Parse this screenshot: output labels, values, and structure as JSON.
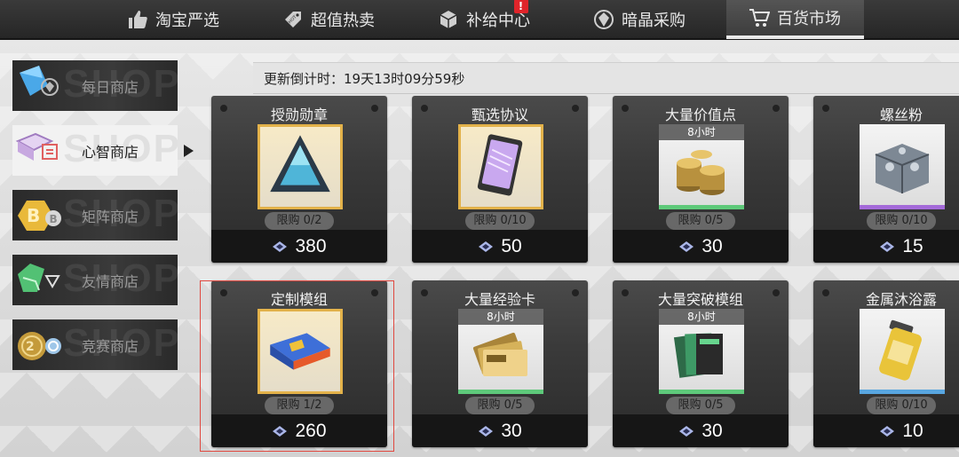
{
  "nav": {
    "tabs": [
      {
        "label": "淘宝严选",
        "icon": "thumbs-up-icon"
      },
      {
        "label": "超值热卖",
        "icon": "hot-tag-icon"
      },
      {
        "label": "补给中心",
        "icon": "supply-box-icon",
        "badge": "!"
      },
      {
        "label": "暗晶采购",
        "icon": "dark-crystal-icon"
      },
      {
        "label": "百货市场",
        "icon": "shopping-cart-icon",
        "active": true
      }
    ]
  },
  "sidebar": {
    "watermark": "SHOP",
    "items": [
      {
        "label": "每日商店",
        "icon": "blue-crystal-icon"
      },
      {
        "label": "心智商店",
        "icon": "mind-chip-icon",
        "active": true
      },
      {
        "label": "矩阵商店",
        "icon": "bitcoin-coin-icon"
      },
      {
        "label": "友情商店",
        "icon": "friendship-gem-icon"
      },
      {
        "label": "竞赛商店",
        "icon": "medal-coin-icon"
      }
    ]
  },
  "countdown": "更新倒计时：19天13时09分59秒",
  "items": [
    {
      "name": "授勋勋章",
      "limit": "限购 0/2",
      "price": "380",
      "icon": "triangle-medal-icon",
      "frame": "gold",
      "timer": ""
    },
    {
      "name": "甄选协议",
      "limit": "限购 0/10",
      "price": "50",
      "icon": "protocol-card-icon",
      "frame": "gold",
      "timer": ""
    },
    {
      "name": "大量价值点",
      "limit": "限购 0/5",
      "price": "30",
      "icon": "coin-stack-icon",
      "frame": "green",
      "timer": "8小时"
    },
    {
      "name": "螺丝粉",
      "limit": "限购 0/10",
      "price": "15",
      "icon": "screw-box-icon",
      "frame": "purple",
      "timer": ""
    },
    {
      "name": "定制模组",
      "limit": "限购 1/2",
      "price": "260",
      "icon": "custom-module-icon",
      "frame": "gold",
      "timer": ""
    },
    {
      "name": "大量经验卡",
      "limit": "限购 0/5",
      "price": "30",
      "icon": "exp-card-icon",
      "frame": "green",
      "timer": "8小时"
    },
    {
      "name": "大量突破模组",
      "limit": "限购 0/5",
      "price": "30",
      "icon": "breakthrough-module-icon",
      "frame": "green",
      "timer": "8小时"
    },
    {
      "name": "金属沐浴露",
      "limit": "限购 0/10",
      "price": "10",
      "icon": "metal-shower-gel-icon",
      "frame": "blue",
      "timer": ""
    }
  ],
  "colors": {
    "gold_frame": "#e3b24a",
    "green_bar": "#5ec97a",
    "purple_bar": "#a46ad9",
    "blue_bar": "#58a6e0",
    "selected_border": "#e0483f",
    "alert_badge": "#e0242a"
  }
}
